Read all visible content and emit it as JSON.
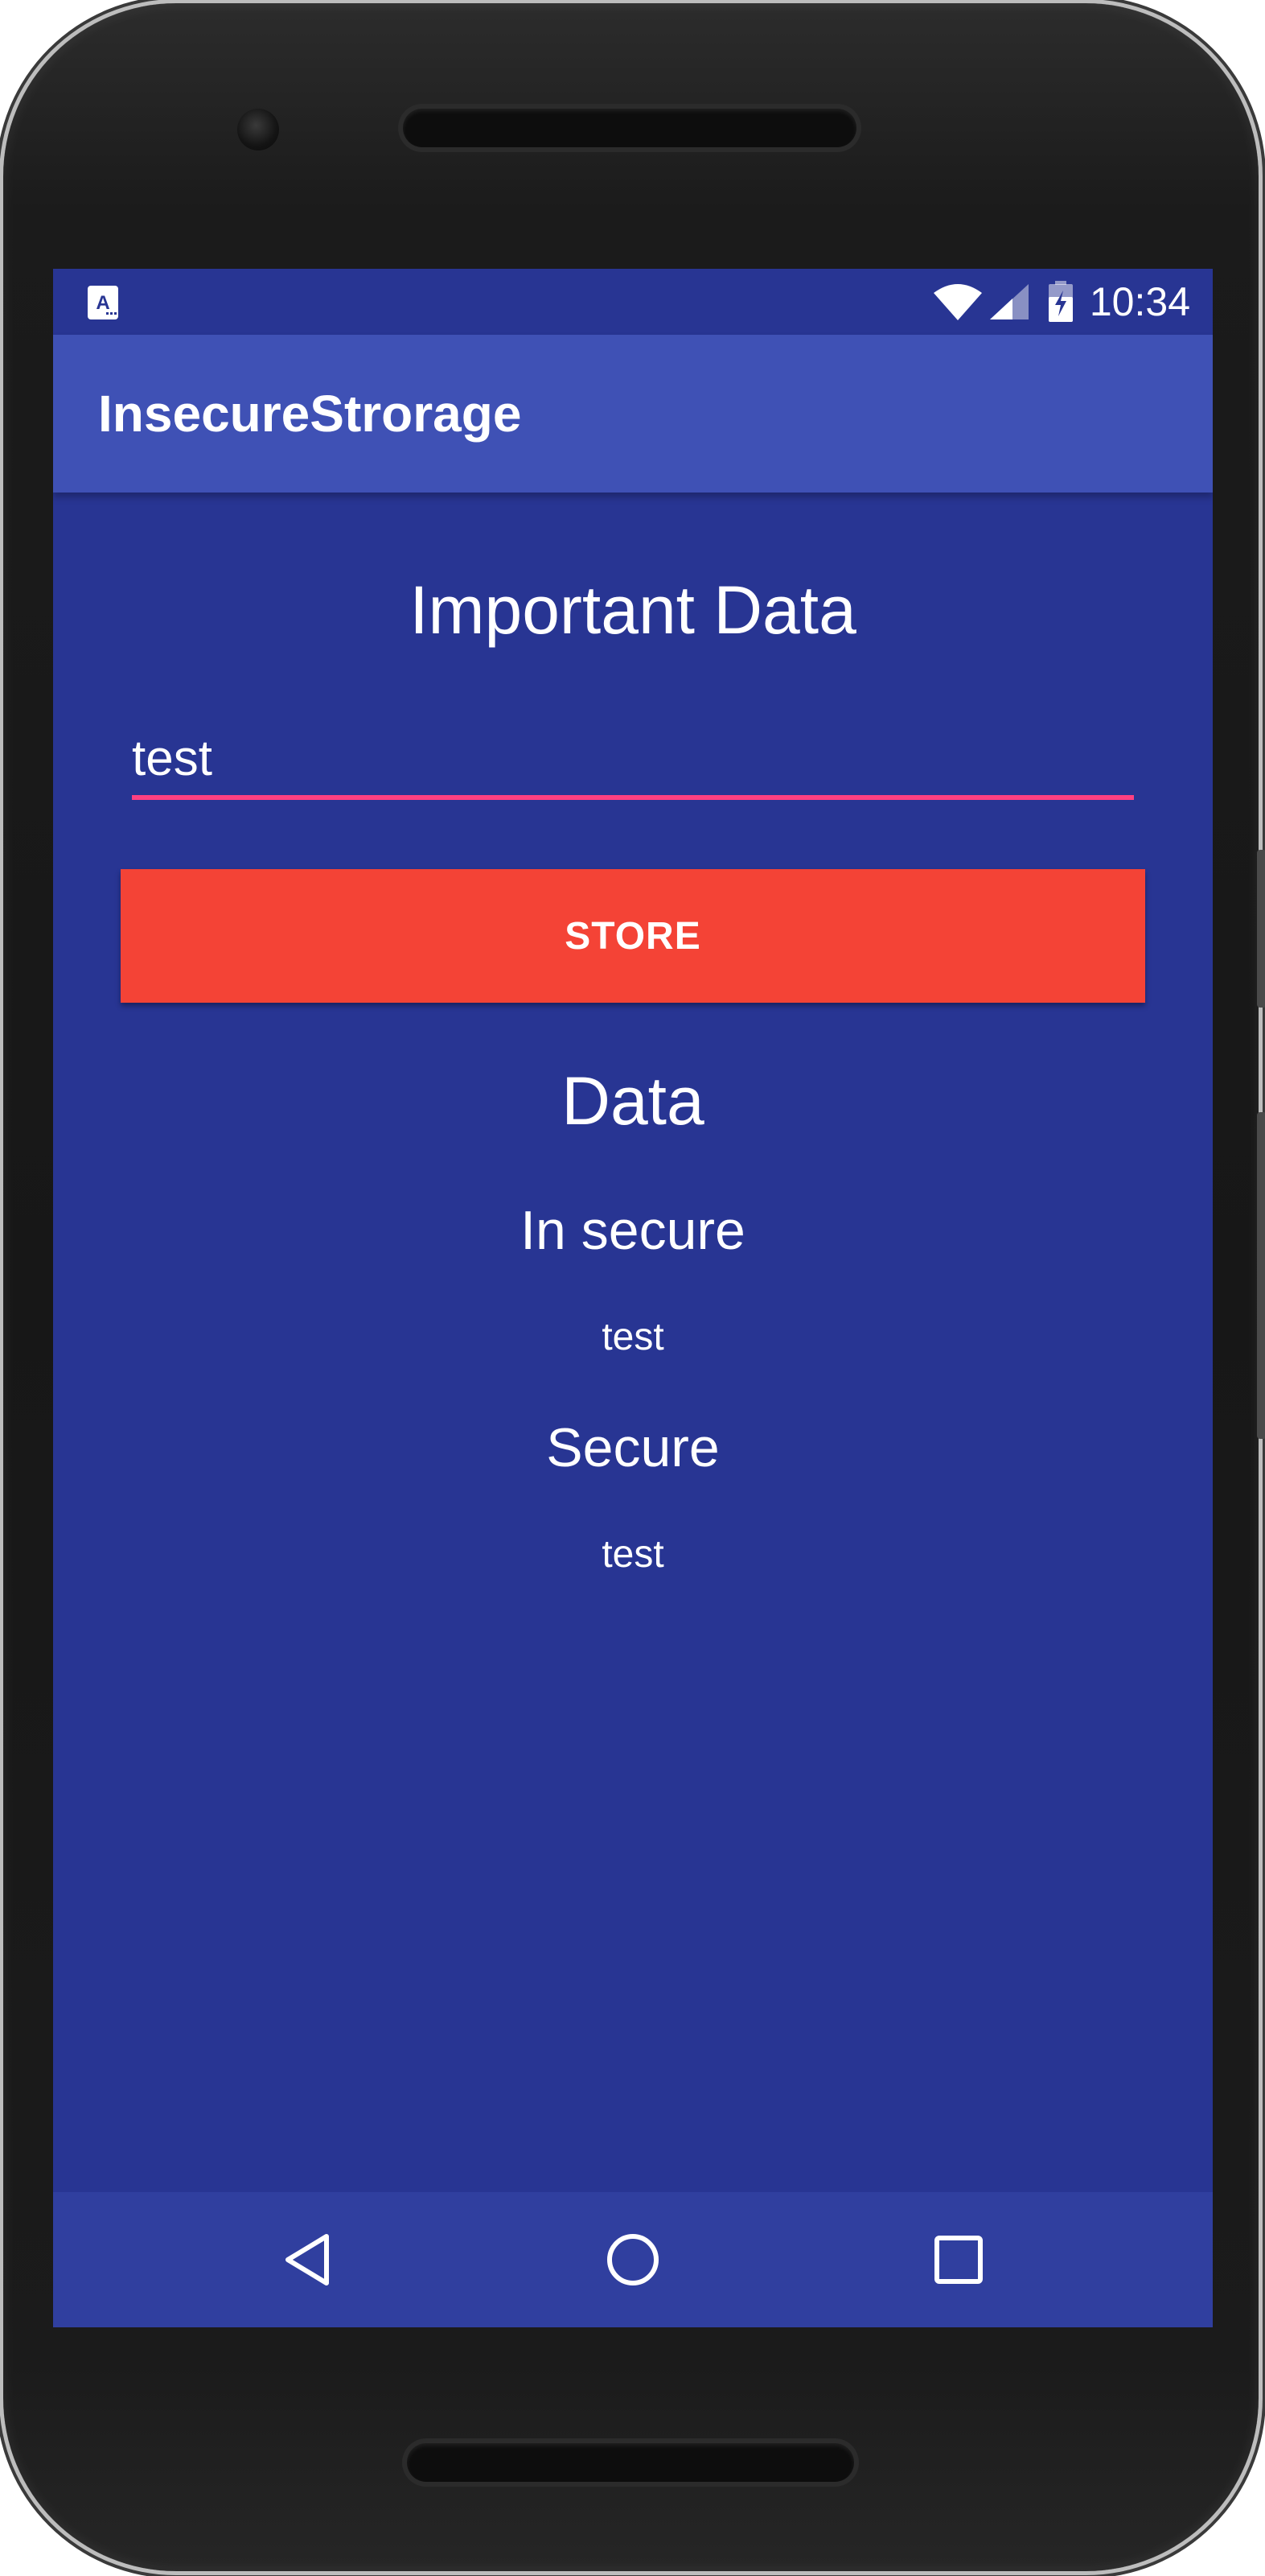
{
  "status_bar": {
    "notification_icon": "a-notification-icon",
    "wifi_icon": "wifi-icon",
    "signal_icon": "signal-icon",
    "battery_icon": "battery-charging-icon",
    "time": "10:34"
  },
  "app_bar": {
    "title": "InsecureStrorage"
  },
  "main": {
    "heading": "Important Data",
    "input_value": "test",
    "store_label": "STORE",
    "data_heading": "Data",
    "insecure_label": "In secure",
    "insecure_value": "test",
    "secure_label": "Secure",
    "secure_value": "test"
  },
  "nav_bar": {
    "back_icon": "back-icon",
    "home_icon": "home-icon",
    "recents_icon": "recents-icon"
  },
  "colors": {
    "primary": "#3f51b5",
    "primary_dark": "#283593",
    "accent": "#ff4081",
    "button": "#f44336",
    "nav_bar": "#303f9f"
  }
}
